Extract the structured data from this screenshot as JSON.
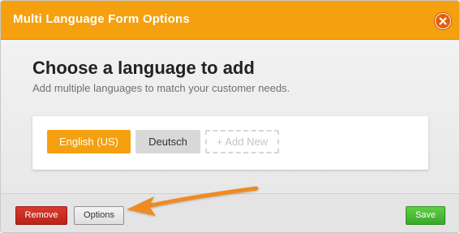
{
  "dialog": {
    "title": "Multi Language Form Options",
    "close_icon": "close-icon",
    "accent_color": "#f5a00f"
  },
  "main": {
    "heading": "Choose a language to add",
    "subheading": "Add multiple languages to match your customer needs.",
    "languages": [
      {
        "label": "English (US)",
        "active": true
      },
      {
        "label": "Deutsch",
        "active": false
      }
    ],
    "add_new_label": "+ Add New"
  },
  "footer": {
    "remove_label": "Remove",
    "options_label": "Options",
    "save_label": "Save",
    "remove_color": "#c92d20",
    "save_color": "#45b832"
  },
  "annotation": {
    "icon": "arrow-icon",
    "color": "#f08a24"
  }
}
